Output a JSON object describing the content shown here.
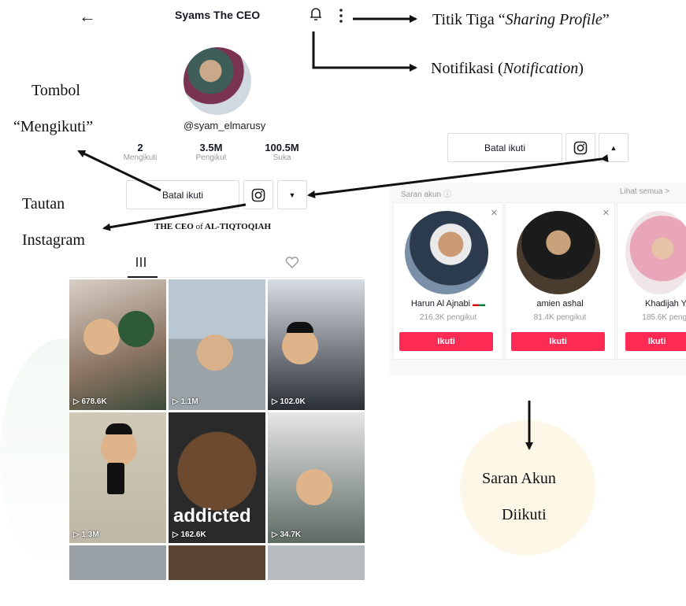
{
  "profile": {
    "back_icon": "back-arrow-icon",
    "title": "Syams The CEO",
    "handle": "@syam_elmarusy",
    "stats": [
      {
        "value": "2",
        "label": "Mengikuti"
      },
      {
        "value": "3.5M",
        "label": "Pengikut"
      },
      {
        "value": "100.5M",
        "label": "Suka"
      }
    ],
    "unfollow_label": "Batal ikuti",
    "tagline_pre": "THE CEO ",
    "tagline_of": "of",
    "tagline_post": " AL-TIQTOQIAH"
  },
  "videos": [
    {
      "views": "678.6K"
    },
    {
      "views": "1.1M"
    },
    {
      "views": "102.0K"
    },
    {
      "views": "1.3M"
    },
    {
      "views": "162.6K",
      "overlay": "addicted"
    },
    {
      "views": "34.7K"
    }
  ],
  "suggestions": {
    "header": "Saran akun",
    "see_all": "Lihat semua >",
    "unfollow_label": "Batal ikuti",
    "follow_label": "Ikuti",
    "accounts": [
      {
        "name": "Harun Al Ajnabi",
        "followers": "216.3K pengikut"
      },
      {
        "name": "amien ashal",
        "followers": "81.4K pengikut"
      },
      {
        "name": "Khadijah Y",
        "followers": "185.6K peng"
      }
    ]
  },
  "annotations": {
    "three_dots": "Titik Tiga “Sharing Profile”",
    "three_dots_a": "Titik Tiga “",
    "three_dots_b": "Sharing Profile",
    "three_dots_c": "”",
    "notif_a": "Notifikasi (",
    "notif_b": "Notification",
    "notif_c": ")",
    "follow_btn_1": "Tombol",
    "follow_btn_2": "“Mengikuti”",
    "ig_1": "Tautan",
    "ig_2": "Instagram",
    "sugg_1": "Saran Akun",
    "sugg_2": "Diikuti"
  }
}
